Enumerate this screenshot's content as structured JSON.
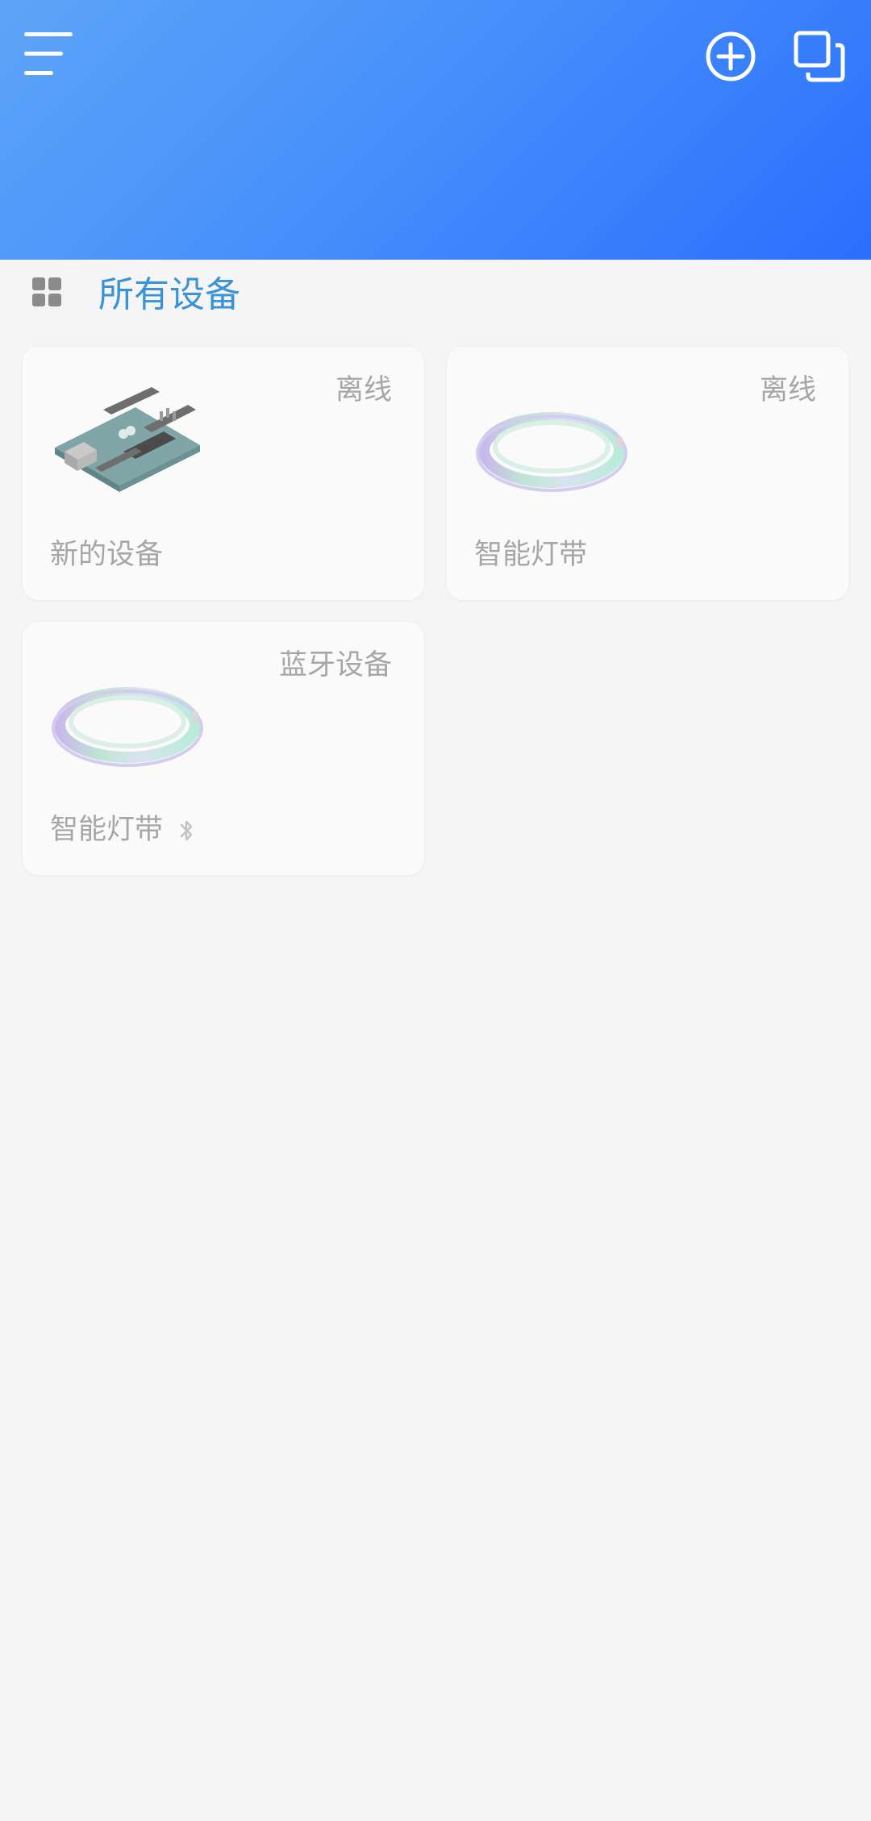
{
  "header": {
    "menu_icon": "hamburger-menu-icon",
    "add_icon": "plus-circle-icon",
    "copy_icon": "copy-squares-icon",
    "gradient_start": "#5ea4f8",
    "gradient_end": "#2a6ffd"
  },
  "section": {
    "icon": "grid-icon",
    "title": "所有设备",
    "title_color": "#3a93d6"
  },
  "devices": [
    {
      "name": "新的设备",
      "status": "离线",
      "image": "arduino-board-image",
      "bluetooth": false
    },
    {
      "name": "智能灯带",
      "status": "离线",
      "image": "led-strip-image",
      "bluetooth": false
    },
    {
      "name": "智能灯带",
      "status": "蓝牙设备",
      "image": "led-strip-image",
      "bluetooth": true
    }
  ]
}
